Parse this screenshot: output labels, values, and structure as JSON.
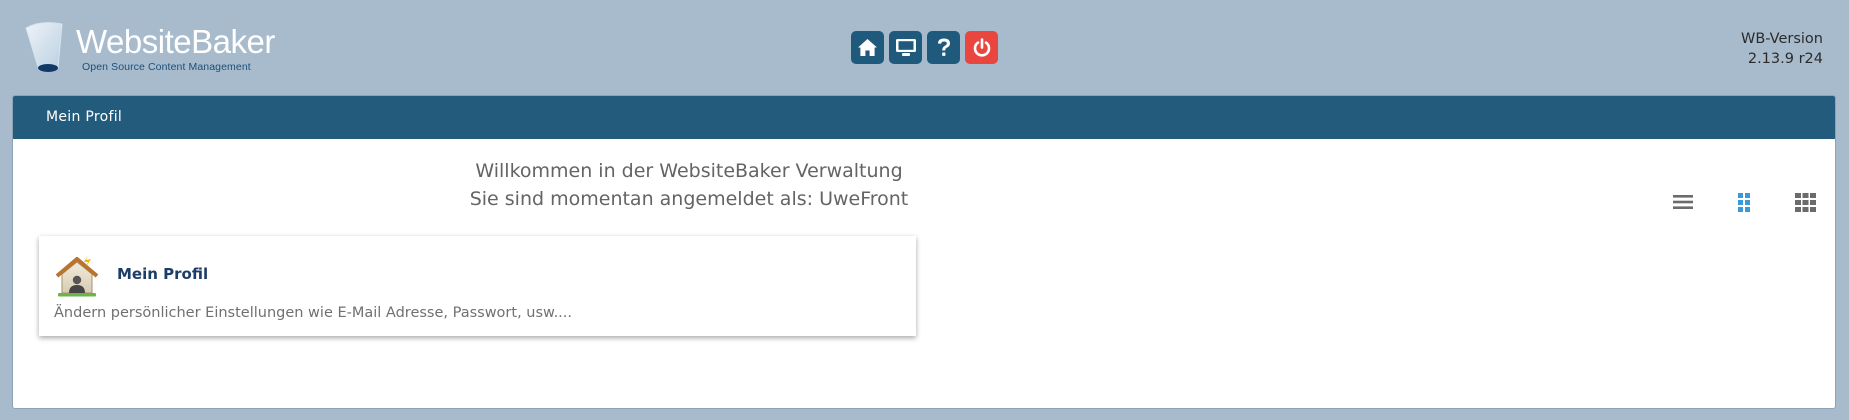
{
  "logo": {
    "name": "WebsiteBaker",
    "tagline": "Open Source Content Management"
  },
  "toolbar": {
    "buttons": [
      {
        "name": "home",
        "icon": "home-icon",
        "color": "#1f5a7d"
      },
      {
        "name": "preview",
        "icon": "monitor-icon",
        "color": "#1f5a7d"
      },
      {
        "name": "help",
        "icon": "question-icon",
        "color": "#1f5a7d"
      },
      {
        "name": "logout",
        "icon": "power-icon",
        "color": "#e8463f"
      }
    ]
  },
  "version": {
    "label": "WB-Version",
    "number": "2.13.9 r24"
  },
  "panel": {
    "title": "Mein Profil",
    "welcome_line1": "Willkommen in der WebsiteBaker Verwaltung",
    "welcome_line2": "Sie sind momentan angemeldet als: UweFront",
    "view_modes": [
      {
        "name": "list",
        "icon": "list-view-icon",
        "active": false
      },
      {
        "name": "medium-grid",
        "icon": "grid-2-view-icon",
        "active": true
      },
      {
        "name": "small-grid",
        "icon": "grid-3-view-icon",
        "active": false
      }
    ],
    "view_active_color": "#3a9ad9"
  },
  "cards": [
    {
      "title": "Mein Profil",
      "description": "Ändern persönlicher Einstellungen wie E-Mail Adresse, Passwort, usw....",
      "icon": "user-profile-icon"
    }
  ]
}
